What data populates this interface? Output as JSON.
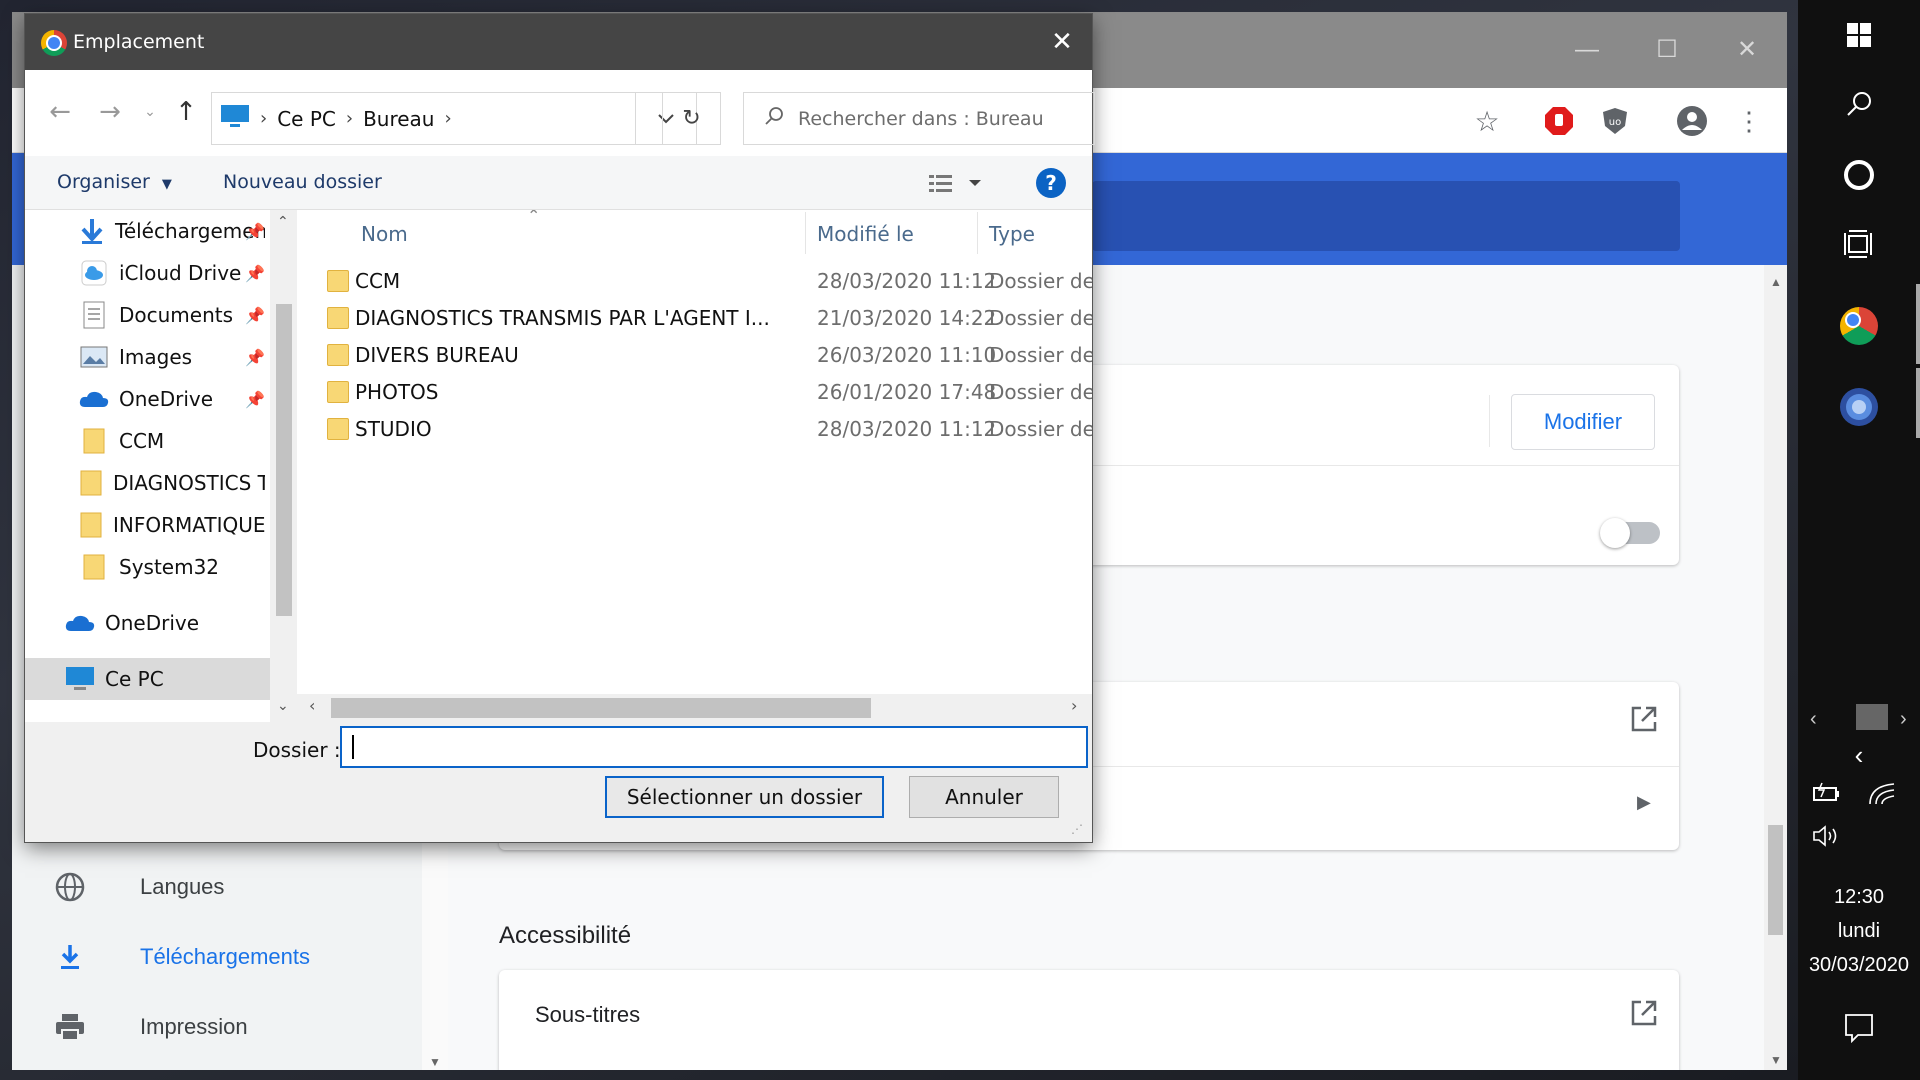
{
  "dialog": {
    "title": "Emplacement",
    "breadcrumb": [
      "Ce PC",
      "Bureau"
    ],
    "search_placeholder": "Rechercher dans : Bureau",
    "organize_label": "Organiser",
    "new_folder_label": "Nouveau dossier",
    "help_label": "?",
    "tree": [
      {
        "label": "Téléchargements",
        "icon": "download-arrow-icon",
        "pinned": true
      },
      {
        "label": "iCloud Drive",
        "icon": "icloud-icon",
        "pinned": true
      },
      {
        "label": "Documents",
        "icon": "documents-icon",
        "pinned": true
      },
      {
        "label": "Images",
        "icon": "images-icon",
        "pinned": true
      },
      {
        "label": "OneDrive",
        "icon": "onedrive-cloud-icon",
        "pinned": true
      },
      {
        "label": "CCM",
        "icon": "folder-icon"
      },
      {
        "label": "DIAGNOSTICS TR",
        "icon": "folder-icon"
      },
      {
        "label": "INFORMATIQUE",
        "icon": "folder-icon"
      },
      {
        "label": "System32",
        "icon": "folder-icon"
      },
      {
        "label": "OneDrive",
        "icon": "onedrive-cloud-icon"
      },
      {
        "label": "Ce PC",
        "icon": "pc-icon",
        "selected": true
      }
    ],
    "columns": {
      "name": "Nom",
      "modified": "Modifié le",
      "type": "Type"
    },
    "files": [
      {
        "name": "CCM",
        "modified": "28/03/2020 11:12",
        "type": "Dossier de"
      },
      {
        "name": "DIAGNOSTICS TRANSMIS PAR L'AGENT I...",
        "modified": "21/03/2020 14:22",
        "type": "Dossier de"
      },
      {
        "name": "DIVERS BUREAU",
        "modified": "26/03/2020 11:10",
        "type": "Dossier de"
      },
      {
        "name": "PHOTOS",
        "modified": "26/01/2020 17:48",
        "type": "Dossier de"
      },
      {
        "name": "STUDIO",
        "modified": "28/03/2020 11:12",
        "type": "Dossier de"
      }
    ],
    "folder_label": "Dossier :",
    "folder_value": "",
    "select_button": "Sélectionner un dossier",
    "cancel_button": "Annuler"
  },
  "chrome_settings": {
    "modify_button": "Modifier",
    "nav": [
      {
        "label": "Langues",
        "icon": "globe-icon"
      },
      {
        "label": "Téléchargements",
        "icon": "download-icon",
        "active": true
      },
      {
        "label": "Impression",
        "icon": "printer-icon"
      }
    ],
    "section_title": "Accessibilité",
    "subtitles_label": "Sous-titres"
  },
  "taskbar": {
    "time": "12:30",
    "day": "lundi",
    "date": "30/03/2020"
  },
  "colors": {
    "accent": "#1a73e8",
    "dialog_title_bg": "#454545",
    "chrome_blue": "#3367d6"
  }
}
